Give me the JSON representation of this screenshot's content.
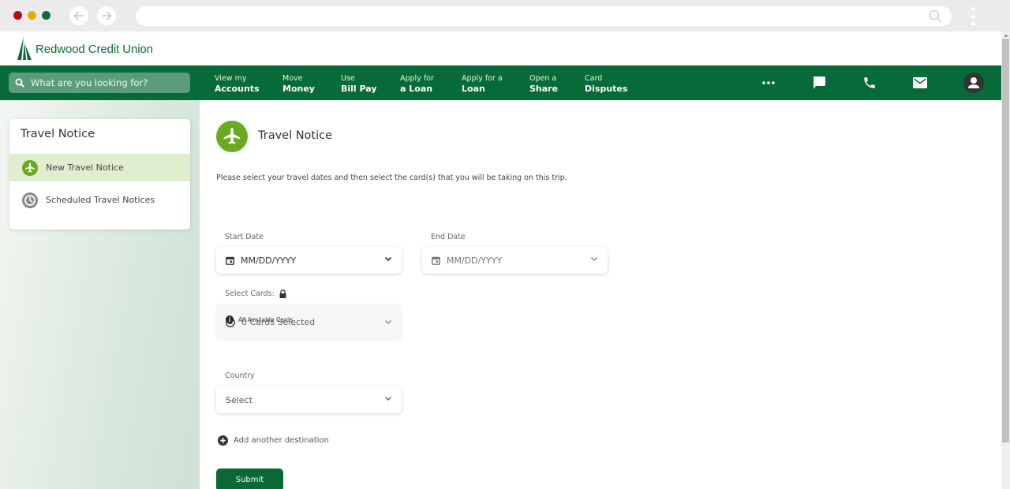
{
  "browser": {
    "url": "",
    "back_icon": "arrow-left-icon",
    "forward_icon": "arrow-right-icon"
  },
  "brand": {
    "name": "Redwood Credit Union",
    "color": "#066b38",
    "accent": "#6aaa1f"
  },
  "topnav": {
    "search_placeholder": "What are you looking for?",
    "items": [
      {
        "small": "View my",
        "big": "Accounts"
      },
      {
        "small": "Move",
        "big": "Money"
      },
      {
        "small": "Use",
        "big": "Bill Pay"
      },
      {
        "small": "Apply for",
        "big": "a Loan"
      },
      {
        "small": "Apply for a",
        "big": "Loan"
      },
      {
        "small": "Open a",
        "big": "Share"
      },
      {
        "small": "Card",
        "big": "Disputes"
      }
    ],
    "icons": [
      "more-icon",
      "chat-icon",
      "phone-icon",
      "mail-icon",
      "user-avatar-icon"
    ]
  },
  "sidebar": {
    "title": "Travel Notice",
    "items": [
      {
        "label": "New Travel Notice",
        "icon": "airplane-icon",
        "active": true
      },
      {
        "label": "Scheduled Travel Notices",
        "icon": "clock-icon",
        "active": false
      }
    ]
  },
  "main": {
    "title": "Travel Notice",
    "instructions": "Please select your travel dates and then select the card(s) that you will be taking on this trip.",
    "start_date": {
      "label": "Start Date",
      "placeholder": "MM/DD/YYYY"
    },
    "end_date": {
      "label": "End Date",
      "placeholder": "MM/DD/YYYY"
    },
    "cards": {
      "label": "Select Cards:",
      "value": "0 Cards Selected",
      "hint": "All Available Cards"
    },
    "country": {
      "label": "Country",
      "value": "Select"
    },
    "add_destination": "Add another destination",
    "submit": "Submit"
  }
}
